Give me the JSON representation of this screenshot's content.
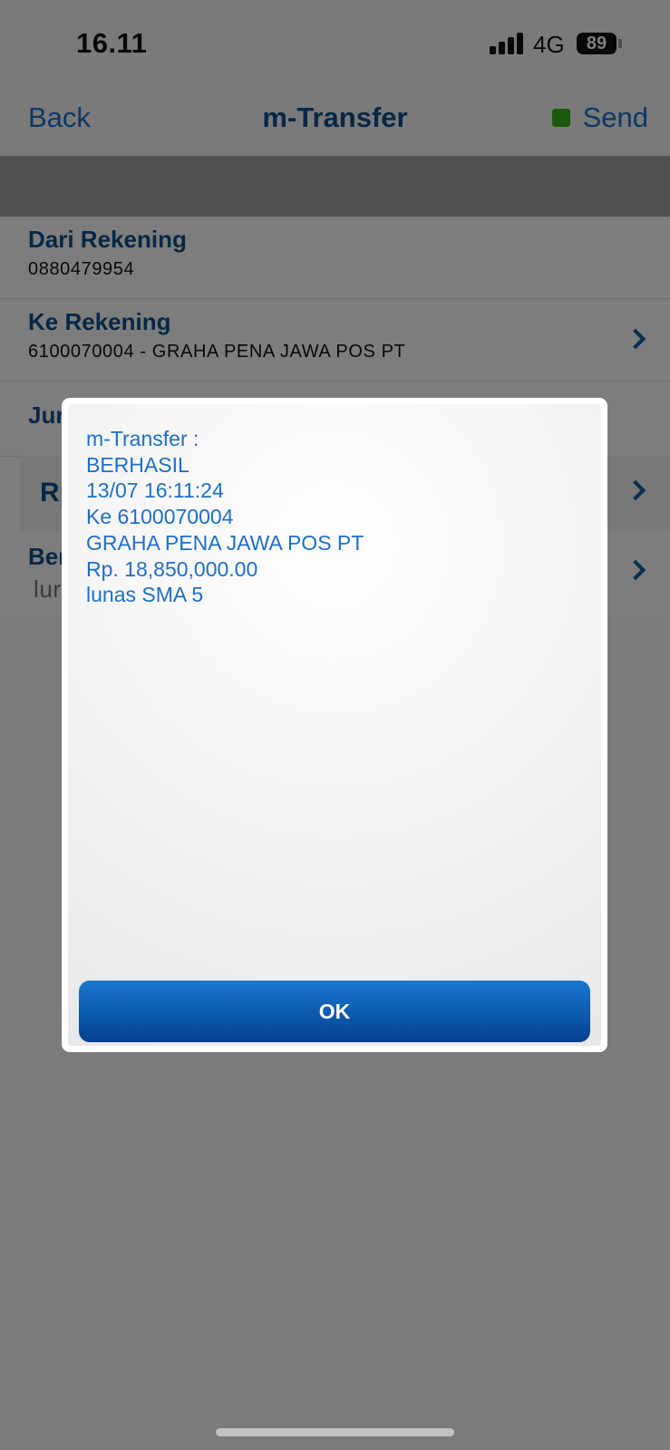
{
  "status_bar": {
    "time": "16.11",
    "network": "4G",
    "battery_level": "89"
  },
  "nav": {
    "back_label": "Back",
    "title": "m-Transfer",
    "send_label": "Send",
    "send_indicator_color": "#39b01a"
  },
  "form": {
    "from_account": {
      "label": "Dari Rekening",
      "value": "0880479954"
    },
    "to_account": {
      "label": "Ke Rekening",
      "value": "6100070004 - GRAHA PENA JAWA POS PT"
    },
    "amount": {
      "label_visible": "Jur",
      "prefix_visible": "Rp"
    },
    "news": {
      "label_visible": "Ber",
      "value_visible": "lur"
    }
  },
  "dialog": {
    "lines": [
      "m-Transfer :",
      "BERHASIL",
      "13/07 16:11:24",
      "Ke 6100070004",
      "GRAHA PENA JAWA POS PT",
      "Rp. 18,850,000.00",
      "lunas SMA 5"
    ],
    "ok_label": "OK"
  },
  "colors": {
    "accent": "#1f6fc9",
    "title_blue": "#0f4f8c",
    "button_blue": "#0c5aae"
  }
}
